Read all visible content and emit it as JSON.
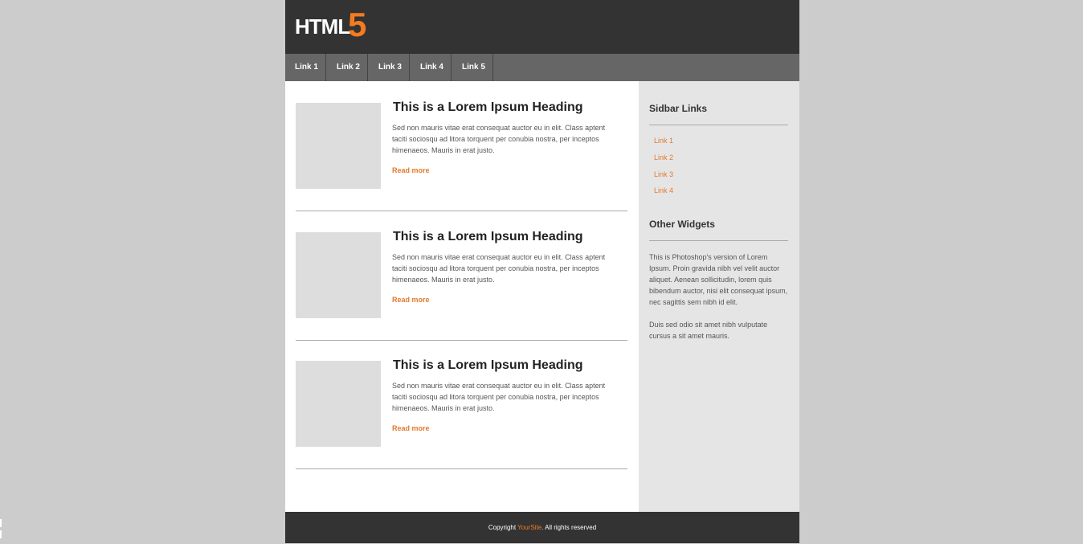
{
  "logo": {
    "text": "HTML",
    "number": "5"
  },
  "nav": {
    "items": [
      "Link 1",
      "Link 2",
      "Link 3",
      "Link 4",
      "Link 5"
    ]
  },
  "articles": [
    {
      "title": "This is a Lorem Ipsum Heading",
      "body": "Sed non mauris vitae erat consequat auctor eu in elit. Class aptent taciti sociosqu ad litora torquent per conubia nostra, per inceptos himenaeos. Mauris in erat justo.",
      "more": "Read more"
    },
    {
      "title": "This is a Lorem Ipsum Heading",
      "body": "Sed non mauris vitae erat consequat auctor eu in elit. Class aptent taciti sociosqu ad litora torquent per conubia nostra, per inceptos himenaeos. Mauris in erat justo.",
      "more": "Read more"
    },
    {
      "title": "This is a Lorem Ipsum Heading",
      "body": "Sed non mauris vitae erat consequat auctor eu in elit. Class aptent taciti sociosqu ad litora torquent per conubia nostra, per inceptos himenaeos. Mauris in erat justo.",
      "more": "Read more"
    }
  ],
  "sidebar": {
    "links_heading": "Sidbar Links",
    "links": [
      "Link 1",
      "Link 2",
      "Link 3",
      "Link 4"
    ],
    "widgets_heading": "Other Widgets",
    "widget_text_1": "This is Photoshop's version of Lorem Ipsum. Proin gravida nibh vel velit auctor aliquet. Aenean sollicitudin, lorem quis bibendum auctor, nisi elit consequat ipsum, nec sagittis sem nibh id elit.",
    "widget_text_2": "Duis sed odio sit amet nibh vulputate cursus a sit amet mauris."
  },
  "footer": {
    "prefix": "Copyright ",
    "brand": "YourSite",
    "suffix": ". All rights reserved"
  },
  "colors": {
    "accent": "#f47b20",
    "header": "#333333",
    "nav": "#666666",
    "sidebar": "#e5e5e5",
    "page": "#cccccc"
  }
}
